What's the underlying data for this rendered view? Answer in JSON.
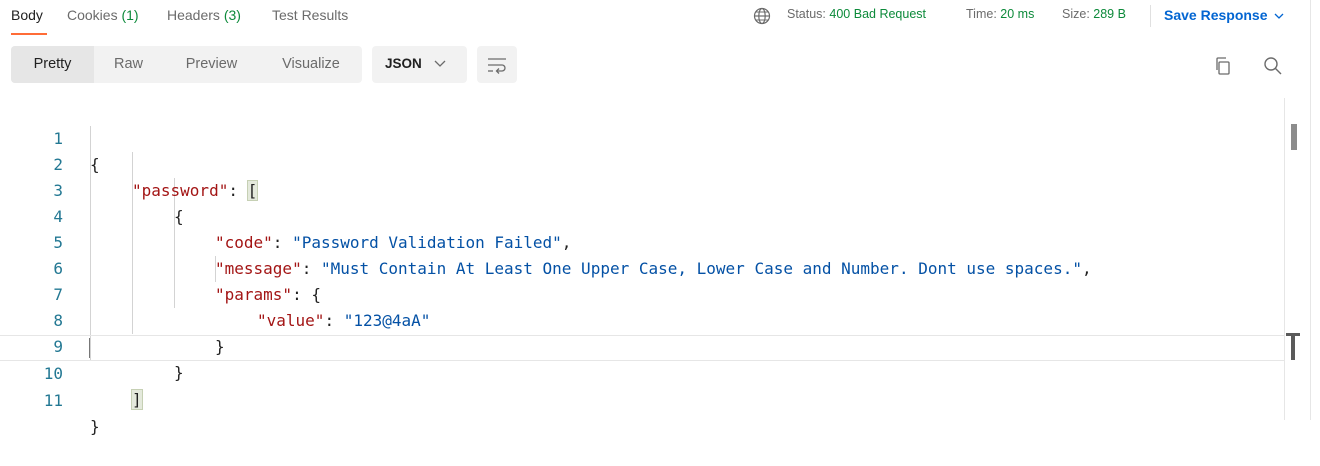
{
  "tabs": {
    "body": "Body",
    "cookies": "Cookies",
    "cookies_count": "(1)",
    "headers": "Headers",
    "headers_count": "(3)",
    "test_results": "Test Results"
  },
  "status": {
    "status_label": "Status:",
    "status_value": "400 Bad Request",
    "time_label": "Time:",
    "time_value": "20 ms",
    "size_label": "Size:",
    "size_value": "289 B"
  },
  "save_response": "Save Response",
  "view_modes": [
    "Pretty",
    "Raw",
    "Preview",
    "Visualize"
  ],
  "format": "JSON",
  "code_lines": [
    {
      "num": "1"
    },
    {
      "num": "2"
    },
    {
      "num": "3"
    },
    {
      "num": "4"
    },
    {
      "num": "5"
    },
    {
      "num": "6"
    },
    {
      "num": "7"
    },
    {
      "num": "8"
    },
    {
      "num": "9"
    },
    {
      "num": "10"
    },
    {
      "num": "11"
    }
  ],
  "code": {
    "l1": "{",
    "l2_key": "\"password\"",
    "l2_sep": ": ",
    "l2_bracket": "[",
    "l3": "{",
    "l4_key": "\"code\"",
    "l4_sep": ": ",
    "l4_val": "\"Password Validation Failed\"",
    "l4_end": ",",
    "l5_key": "\"message\"",
    "l5_sep": ": ",
    "l5_val": "\"Must Contain At Least One Upper Case, Lower Case and Number. Dont use spaces.\"",
    "l5_end": ",",
    "l6_key": "\"params\"",
    "l6_sep": ": {",
    "l7_key": "\"value\"",
    "l7_sep": ": ",
    "l7_val": "\"123@4aA\"",
    "l8": "}",
    "l9": "}",
    "l10": "]",
    "l11": "}"
  },
  "colors": {
    "accent": "#ff6c37",
    "status_ok": "#0c8a3a",
    "link": "#0265d2",
    "json_key": "#a31515",
    "json_string": "#0451a5",
    "line_number": "#237893"
  }
}
